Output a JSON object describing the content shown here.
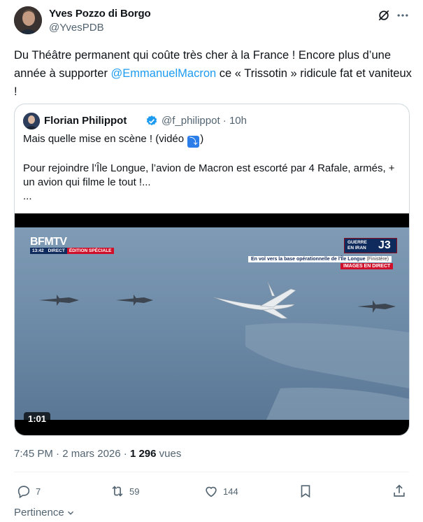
{
  "author": {
    "name": "Yves Pozzo di Borgo",
    "handle": "@YvesPDB"
  },
  "tweet": {
    "text_before": "Du Théâtre permanent qui coûte très cher à la France ! Encore plus d’une année à supporter ",
    "mention": "@EmmanuelMacron",
    "text_after": " ce « Trissotin » ridicule fat et vaniteux !"
  },
  "quote": {
    "name": "Florian Philippot",
    "handle": "@f_philippot",
    "time": "10h",
    "line1_before": "Mais quelle mise en scène ! (vidéo ",
    "line1_emoji": "⤵",
    "line1_after": ")",
    "line2": "Pour rejoindre l’Île Longue, l’avion de Macron est escorté par 4 Rafale, armés, +",
    "line3": "un avion qui filme le tout !...",
    "line4": "...",
    "video": {
      "channel": "BFMTV",
      "clock": "13:42",
      "live": "DIRECT",
      "special": "ÉDITION SPÉCIALE",
      "banner_label": "GUERRE EN IRAN",
      "banner_day": "J3",
      "caption": "En vol vers la base opérationnelle de l'Île Longue",
      "caption_place": "(Finistère)",
      "live_tag": "IMAGES EN DIRECT",
      "duration": "1:01"
    }
  },
  "meta": {
    "time": "7:45 PM",
    "separator": " · ",
    "date": "2 mars 2026",
    "views_count": "1 296",
    "views_label": " vues"
  },
  "actions": {
    "replies": "7",
    "reposts": "59",
    "likes": "144"
  },
  "sort": {
    "label": "Pertinence"
  },
  "colors": {
    "accent": "#1d9bf0",
    "muted": "#536471",
    "bfm_blue": "#0f2a5c",
    "bfm_red": "#d0102a"
  }
}
